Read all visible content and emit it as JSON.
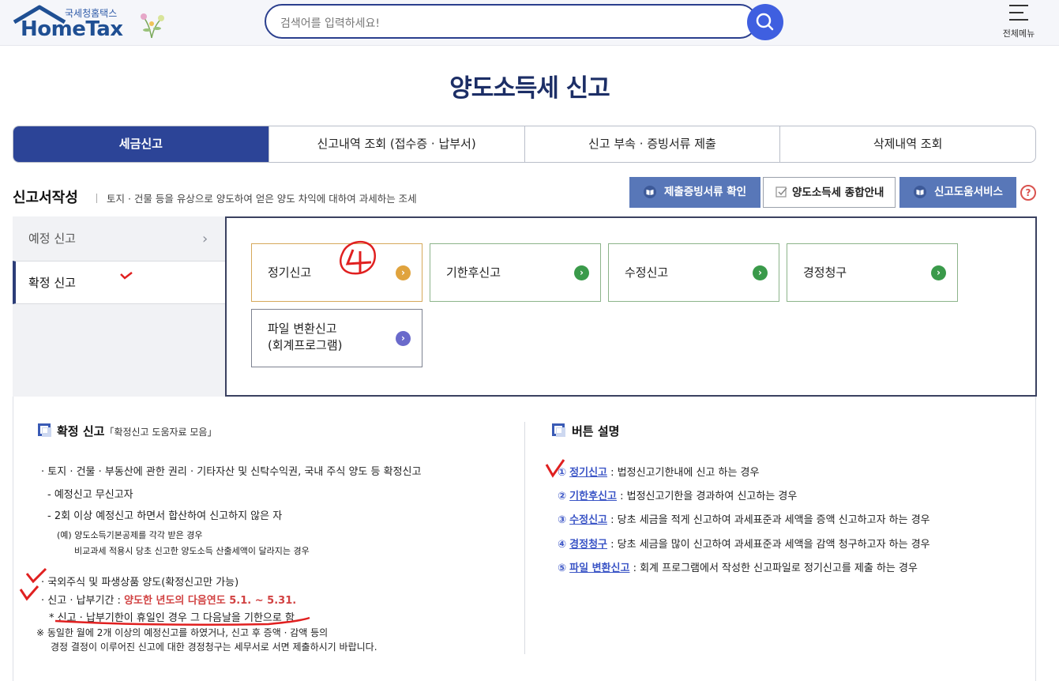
{
  "header": {
    "logo_sub": "국세청홈택스",
    "logo_main": "HomeTax",
    "search_placeholder": "검색어를 입력하세요!",
    "menu_label": "전체메뉴"
  },
  "page_title": "양도소득세 신고",
  "tabs": [
    "세금신고",
    "신고내역 조회 (접수증 · 납부서)",
    "신고 부속 · 증빙서류 제출",
    "삭제내역 조회"
  ],
  "section": {
    "title": "신고서작성",
    "desc": "토지 · 건물 등을 유상으로 양도하여 얻은 양도 차익에 대하여 과세하는 조세",
    "buttons": [
      "제출증빙서류 확인",
      "양도소득세 종합안내",
      "신고도움서비스"
    ],
    "help": "?"
  },
  "left_menu": [
    "예정 신고",
    "확정 신고"
  ],
  "options": [
    "정기신고",
    "기한후신고",
    "수정신고",
    "경정청구"
  ],
  "option_file": [
    "파일 변환신고",
    "(회계프로그램)"
  ],
  "info_left": {
    "title": "확정 신고",
    "title_sub": "「확정신고 도움자료 모음」",
    "l1": "· 토지 · 건물 · 부동산에 관한 권리 · 기타자산 및 신탁수익권, 국내 주식 양도 등 확정신고",
    "l2": "- 예정신고 무신고자",
    "l3": "- 2회 이상 예정신고 하면서 합산하여 신고하지 않은 자",
    "l4": "(예) 양도소득기본공제를 각각 받은 경우",
    "l5": "비교과세 적용시 당초 신고한 양도소득 산출세액이 달라지는 경우",
    "l6": "· 국외주식 및 파생상품 양도(확정신고만 가능)",
    "l7a": "· 신고 · 납부기간 : ",
    "l7b": "양도한 년도의 다음연도 5.1. ~ 5.31.",
    "l8": "* 신고 · 납부기한이 휴일인 경우 그 다음날을 기한으로 함",
    "l9": "※ 동일한 월에 2개 이상의 예정신고를 하였거나, 신고 후 증액 · 감액 등의",
    "l10": "경정 결정이 이루어진 신고에 대한 경정청구는 세무서로 서면 제출하시기 바랍니다."
  },
  "info_right": {
    "title": "버튼 설명",
    "items": [
      {
        "num": "①",
        "name": "정기신고",
        "desc": " : 법정신고기한내에 신고 하는 경우"
      },
      {
        "num": "②",
        "name": "기한후신고",
        "desc": " : 법정신고기한을 경과하여 신고하는 경우"
      },
      {
        "num": "③",
        "name": "수정신고",
        "desc": " : 당초 세금을 적게 신고하여 과세표준과 세액을 증액 신고하고자 하는 경우"
      },
      {
        "num": "④",
        "name": "경정청구",
        "desc": " : 당초 세금을 많이 신고하여 과세표준과 세액을 감액 청구하고자 하는 경우"
      },
      {
        "num": "⑤",
        "name": "파일 변환신고",
        "desc": " : 회계 프로그램에서 작성한 신고파일로 정기신고를  제출 하는 경우"
      }
    ]
  },
  "annotation_mark": "4",
  "colors": {
    "primary": "#2c4497",
    "accent_blue": "#5877b8",
    "red": "#d14141",
    "green": "#3a9a4a"
  }
}
